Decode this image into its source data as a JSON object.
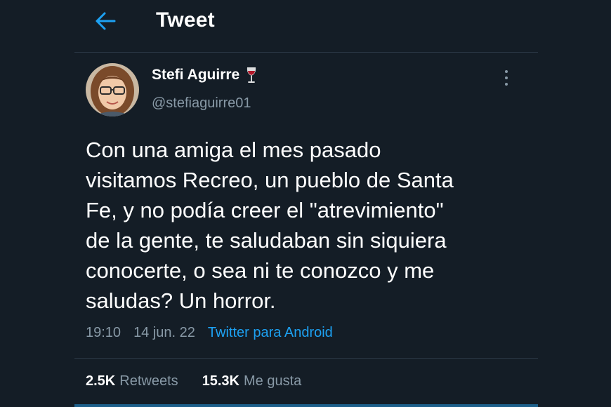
{
  "header": {
    "back_icon": "arrow-left-icon",
    "title": "Tweet"
  },
  "author": {
    "name": "Stefi Aguirre",
    "name_emoji_icon": "wine-glass-icon",
    "handle": "@stefiaguirre01"
  },
  "tweet": {
    "text": "Con una amiga el mes pasado\nvisitamos Recreo, un pueblo de Santa\nFe, y no podía creer el \"atrevimiento\"\nde la gente, te saludaban sin siquiera\nconocerte, o sea ni te conozco y me\nsaludas? Un horror.",
    "time": "19:10",
    "date": "14 jun. 22",
    "source": "Twitter para Android"
  },
  "stats": {
    "retweets_count": "2.5K",
    "retweets_label": "Retweets",
    "likes_count": "15.3K",
    "likes_label": "Me gusta"
  },
  "colors": {
    "background": "#141d26",
    "accent": "#1da1f2",
    "muted_text": "#8899a6",
    "divider": "#2c3946"
  }
}
